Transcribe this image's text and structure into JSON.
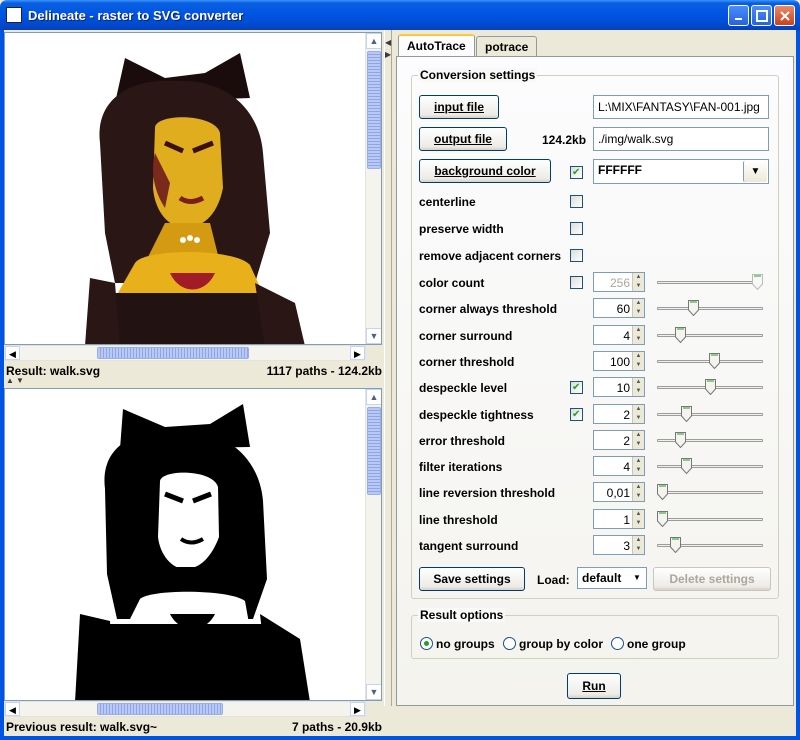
{
  "window": {
    "title": "Delineate - raster to SVG converter"
  },
  "preview_top": {
    "result_label": "Result: walk.svg",
    "result_info": "1117 paths - 124.2kb"
  },
  "preview_bottom": {
    "result_label": "Previous result: walk.svg~",
    "result_info": "7 paths - 20.9kb"
  },
  "tabs": [
    {
      "label": "AutoTrace",
      "selected": true
    },
    {
      "label": "potrace",
      "selected": false
    }
  ],
  "conversion": {
    "legend": "Conversion settings",
    "input_file_label": "input file",
    "input_file_value": "L:\\MIX\\FANTASY\\FAN-001.jpg",
    "output_file_label": "output file",
    "output_size": "124.2kb",
    "output_file_value": "./img/walk.svg",
    "background_label": "background color",
    "background_value": "FFFFFF",
    "centerline": "centerline",
    "preserve_width": "preserve width",
    "remove_adjacent": "remove adjacent corners",
    "params": [
      {
        "label": "color count",
        "value": "256",
        "checkbox": true,
        "checked": false,
        "enabled": false,
        "level": 1.0
      },
      {
        "label": "corner always threshold",
        "value": "60",
        "checkbox": false,
        "enabled": true,
        "level": 0.33
      },
      {
        "label": "corner surround",
        "value": "4",
        "checkbox": false,
        "enabled": true,
        "level": 0.19
      },
      {
        "label": "corner threshold",
        "value": "100",
        "checkbox": false,
        "enabled": true,
        "level": 0.55
      },
      {
        "label": "despeckle level",
        "value": "10",
        "checkbox": true,
        "checked": true,
        "enabled": true,
        "level": 0.5
      },
      {
        "label": "despeckle tightness",
        "value": "2",
        "checkbox": true,
        "checked": true,
        "enabled": true,
        "level": 0.25
      },
      {
        "label": "error threshold",
        "value": "2",
        "checkbox": false,
        "enabled": true,
        "level": 0.19
      },
      {
        "label": "filter iterations",
        "value": "4",
        "checkbox": false,
        "enabled": true,
        "level": 0.25
      },
      {
        "label": "line reversion threshold",
        "value": "0,01",
        "checkbox": false,
        "enabled": true,
        "level": 0.0
      },
      {
        "label": "line threshold",
        "value": "1",
        "checkbox": false,
        "enabled": true,
        "level": 0.0
      },
      {
        "label": "tangent surround",
        "value": "3",
        "checkbox": false,
        "enabled": true,
        "level": 0.14
      }
    ],
    "save_label": "Save settings",
    "load_label": "Load:",
    "load_value": "default",
    "delete_label": "Delete settings"
  },
  "result_options": {
    "legend": "Result options",
    "options": [
      {
        "label": "no groups",
        "selected": true
      },
      {
        "label": "group by color",
        "selected": false
      },
      {
        "label": "one group",
        "selected": false
      }
    ]
  },
  "run_label": "Run"
}
